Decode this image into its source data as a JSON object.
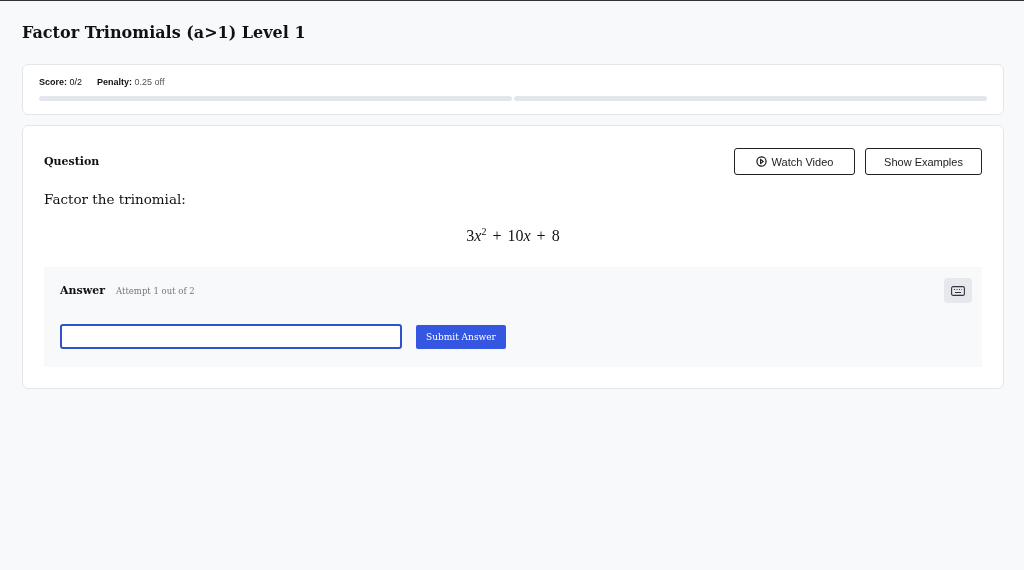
{
  "title": "Factor Trinomials (a>1) Level 1",
  "progress": {
    "score_label": "Score:",
    "score": "0/2",
    "penalty_label": "Penalty:",
    "penalty": "0.25 off"
  },
  "question": {
    "heading": "Question",
    "buttons": [
      {
        "label": "Watch Video",
        "kind": "video"
      },
      {
        "label": "Show Examples",
        "kind": "plain"
      }
    ],
    "prompt": "Factor the trinomial:",
    "expression": [
      {
        "kind": "num",
        "text": "3"
      },
      {
        "kind": "var",
        "text": "x"
      },
      {
        "kind": "sup",
        "text": "2"
      },
      {
        "kind": "op",
        "text": "+"
      },
      {
        "kind": "num",
        "text": "10"
      },
      {
        "kind": "var",
        "text": "x"
      },
      {
        "kind": "op",
        "text": "+"
      },
      {
        "kind": "num",
        "text": "8"
      }
    ]
  },
  "answer": {
    "heading": "Answer",
    "attempt": "Attempt 1 out of 2",
    "submit": "Submit Answer"
  }
}
